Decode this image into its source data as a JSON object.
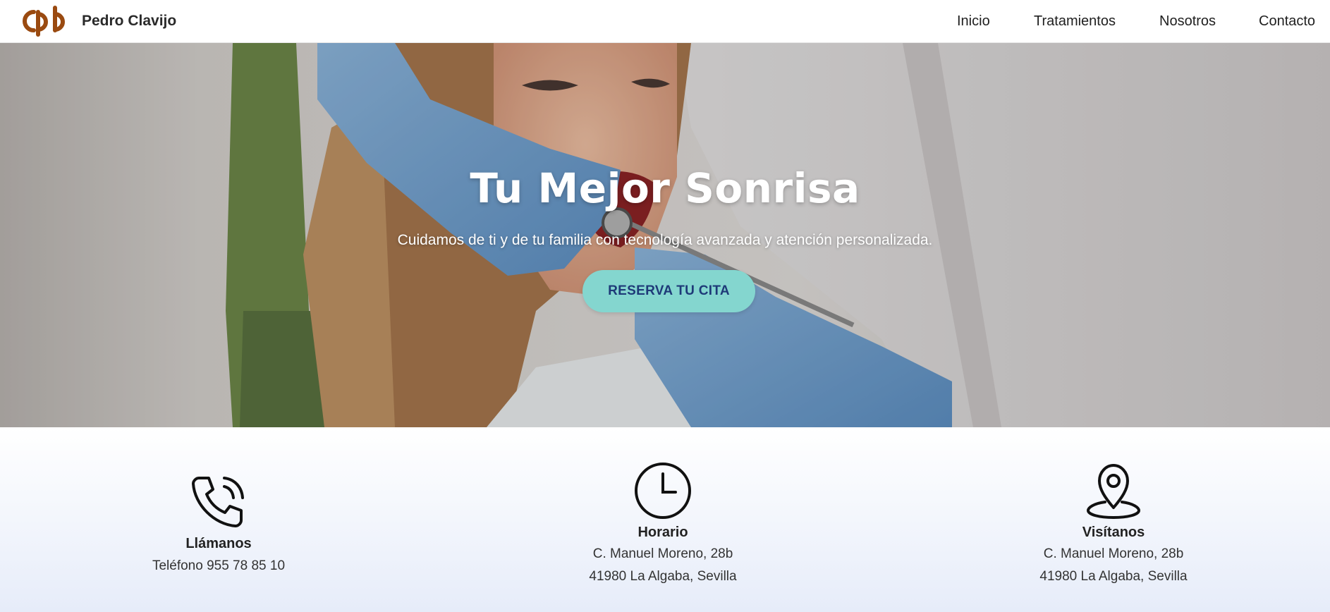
{
  "header": {
    "brand_name": "Pedro Clavijo",
    "brand_color": "#9a4a10",
    "nav": [
      {
        "label": "Inicio"
      },
      {
        "label": "Tratamientos"
      },
      {
        "label": "Nosotros"
      },
      {
        "label": "Contacto"
      }
    ]
  },
  "hero": {
    "title": "Tu Mejor Sonrisa",
    "subtitle": "Cuidamos de ti y de tu familia con tecnología avanzada y atención personalizada.",
    "cta_label": "RESERVA TU CITA",
    "cta_color": "#84d6cf",
    "cta_text_color": "#1e3a78",
    "background_image": "dental-patient-photo"
  },
  "info": {
    "cards": [
      {
        "icon": "phone-icon",
        "title": "Llámanos",
        "lines": [
          "Teléfono 955 78 85 10"
        ]
      },
      {
        "icon": "clock-icon",
        "title": "Horario",
        "lines": [
          "C. Manuel Moreno, 28b",
          "41980 La Algaba, Sevilla"
        ]
      },
      {
        "icon": "location-pin-icon",
        "title": "Visítanos",
        "lines": [
          "C. Manuel Moreno, 28b",
          "41980 La Algaba, Sevilla"
        ]
      }
    ]
  }
}
